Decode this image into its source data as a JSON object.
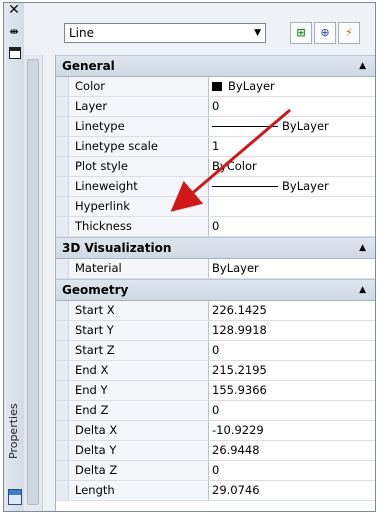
{
  "palette": {
    "title": "Properties",
    "object_type": "Line"
  },
  "sections": [
    {
      "title": "General",
      "rows": [
        {
          "name": "Color",
          "value": "ByLayer",
          "kind": "color"
        },
        {
          "name": "Layer",
          "value": "0"
        },
        {
          "name": "Linetype",
          "value": "ByLayer",
          "kind": "line"
        },
        {
          "name": "Linetype scale",
          "value": "1"
        },
        {
          "name": "Plot style",
          "value": "ByColor"
        },
        {
          "name": "Lineweight",
          "value": "ByLayer",
          "kind": "line"
        },
        {
          "name": "Hyperlink",
          "value": ""
        },
        {
          "name": "Thickness",
          "value": "0"
        }
      ]
    },
    {
      "title": "3D Visualization",
      "rows": [
        {
          "name": "Material",
          "value": "ByLayer"
        }
      ]
    },
    {
      "title": "Geometry",
      "rows": [
        {
          "name": "Start X",
          "value": "226.1425"
        },
        {
          "name": "Start Y",
          "value": "128.9918"
        },
        {
          "name": "Start Z",
          "value": "0"
        },
        {
          "name": "End X",
          "value": "215.2195"
        },
        {
          "name": "End Y",
          "value": "155.9366"
        },
        {
          "name": "End Z",
          "value": "0"
        },
        {
          "name": "Delta X",
          "value": "-10.9229"
        },
        {
          "name": "Delta Y",
          "value": "26.9448"
        },
        {
          "name": "Delta Z",
          "value": "0"
        },
        {
          "name": "Length",
          "value": "29.0746"
        }
      ]
    }
  ],
  "colors": {
    "annotation_arrow": "#d01818",
    "header_bg": "#d6dee9"
  }
}
